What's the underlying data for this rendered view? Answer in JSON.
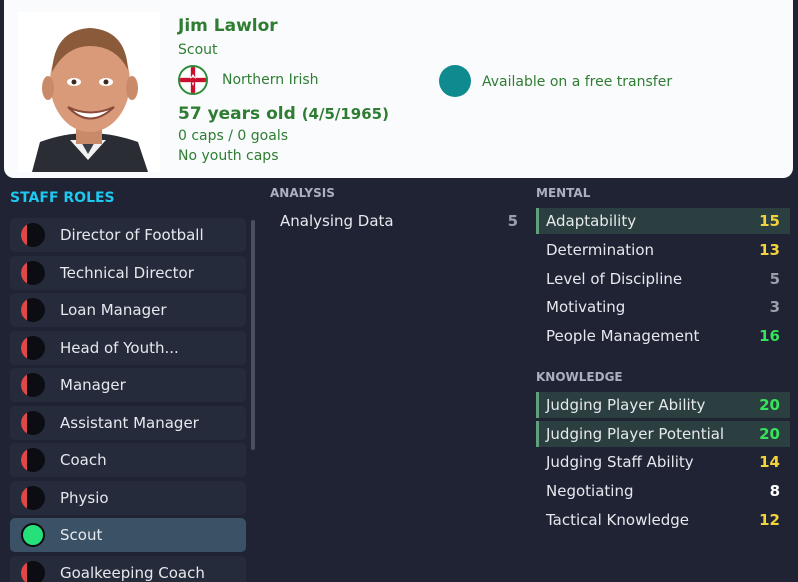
{
  "profile": {
    "name": "Jim Lawlor",
    "role": "Scout",
    "nationality": "Northern Irish",
    "status": "Available on a free transfer",
    "age": "57 years old",
    "dob": "(4/5/1965)",
    "caps": "0 caps / 0 goals",
    "youth_caps": "No youth caps"
  },
  "staff_roles": {
    "title": "STAFF ROLES",
    "items": [
      {
        "label": "Director of Football",
        "active": false
      },
      {
        "label": "Technical Director",
        "active": false
      },
      {
        "label": "Loan Manager",
        "active": false
      },
      {
        "label": "Head of Youth...",
        "active": false
      },
      {
        "label": "Manager",
        "active": false
      },
      {
        "label": "Assistant Manager",
        "active": false
      },
      {
        "label": "Coach",
        "active": false
      },
      {
        "label": "Physio",
        "active": false
      },
      {
        "label": "Scout",
        "active": true
      },
      {
        "label": "Goalkeeping Coach",
        "active": false
      }
    ]
  },
  "analysis": {
    "title": "ANALYSIS",
    "items": [
      {
        "label": "Analysing Data",
        "value": "5"
      }
    ]
  },
  "mental": {
    "title": "MENTAL",
    "items": [
      {
        "label": "Adaptability",
        "value": "15"
      },
      {
        "label": "Determination",
        "value": "13"
      },
      {
        "label": "Level of Discipline",
        "value": "5"
      },
      {
        "label": "Motivating",
        "value": "3"
      },
      {
        "label": "People Management",
        "value": "16"
      }
    ]
  },
  "knowledge": {
    "title": "KNOWLEDGE",
    "items": [
      {
        "label": "Judging Player Ability",
        "value": "20"
      },
      {
        "label": "Judging Player Potential",
        "value": "20"
      },
      {
        "label": "Judging Staff Ability",
        "value": "14"
      },
      {
        "label": "Negotiating",
        "value": "8"
      },
      {
        "label": "Tactical Knowledge",
        "value": "12"
      }
    ]
  },
  "colors": {
    "accent_cyan": "#1fc8f0",
    "header_green": "#2e7d32",
    "value_green": "#35e25a",
    "value_yellow": "#f3d33c",
    "role_off": "#e04848",
    "role_on": "#26e07a"
  }
}
